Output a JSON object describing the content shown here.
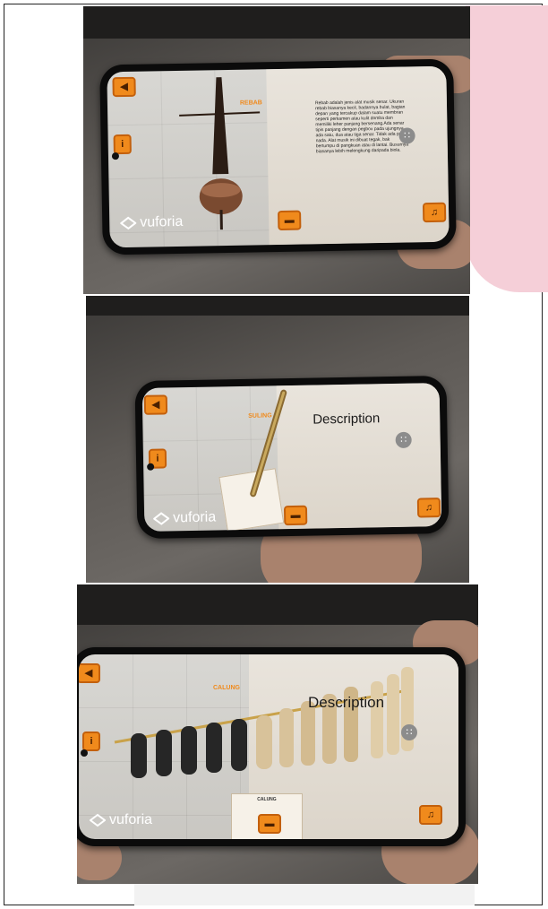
{
  "panels": [
    {
      "id": "rebab",
      "description_text": "Rebab adalah jenis alat musik senar. Ukuran rebab biasanya kecil, badannya bulat, bagian depan yang tercakup dalam suatu membran seperti perkamen atau kulit domba dan memiliki leher panjang bersenang.Ada senar tipis panjang dengan pegbox pada ujungnya ada satu, dua atau tiga senar. Tidak ada papan nada. Alat musik ini dibuat tegak, bak bertumpu di pangkuan atau di lantai. Busurnya biasanya lebih melengkung daripada biola.",
      "title_text": "",
      "instrument_label": "REBAB",
      "card_caption": ""
    },
    {
      "id": "suling",
      "description_text": "",
      "title_text": "Description",
      "instrument_label": "SULING",
      "card_caption": ""
    },
    {
      "id": "calung",
      "description_text": "",
      "title_text": "Description",
      "instrument_label": "CALUNG",
      "card_caption": "CALUNG"
    }
  ],
  "ui": {
    "logo_text": "vuforia",
    "back_icon": "back-arrow-icon",
    "info_icon": "info-icon",
    "menu_icon": "grid-menu-icon",
    "sound_icon": "speaker-icon",
    "accent_color": "#f08a1c"
  }
}
